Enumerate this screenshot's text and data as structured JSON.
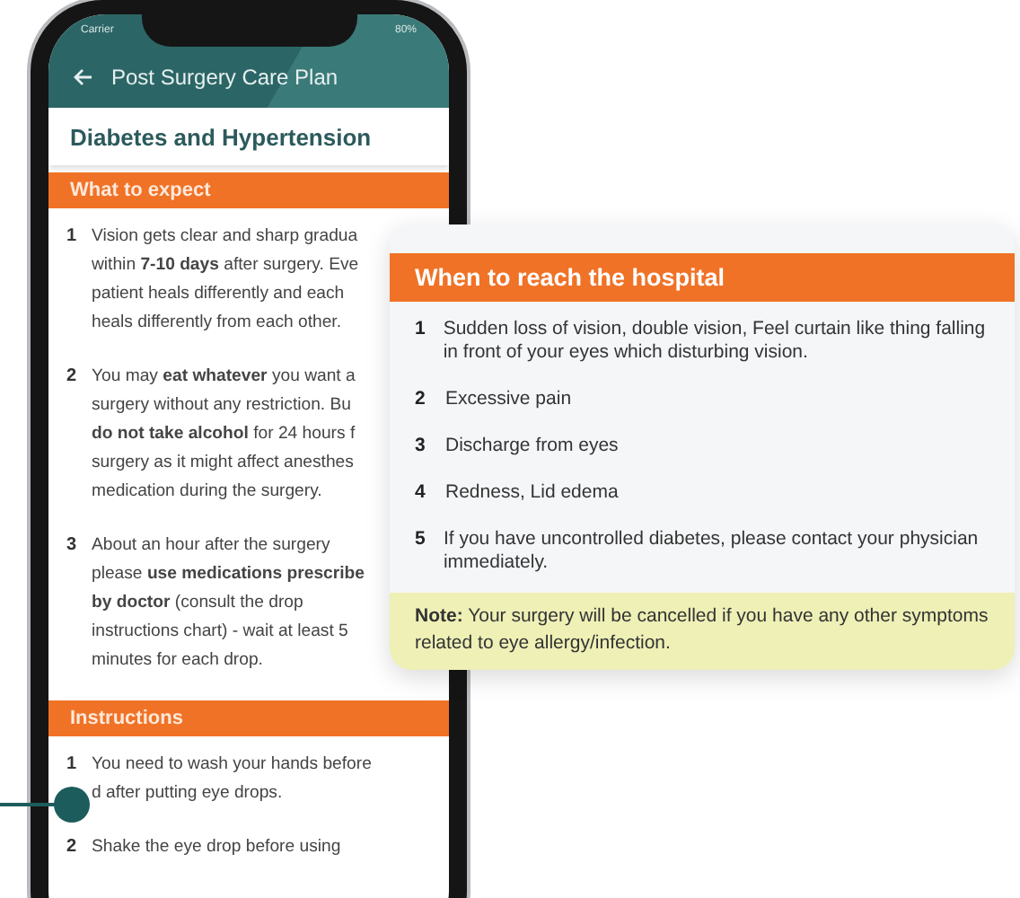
{
  "phone": {
    "status_bar": {
      "carrier": "Carrier",
      "battery": "80%"
    },
    "app_bar": {
      "title": "Post Surgery Care Plan"
    },
    "page_title": "Diabetes and Hypertension",
    "sections": [
      {
        "title": "What to expect",
        "items": [
          {
            "number": "1",
            "lines": [
              "Vision gets clear and sharp gradua",
              "within **7-10 days** after surgery. Eve",
              "patient heals differently and each",
              "heals differently from each other."
            ]
          },
          {
            "number": "2",
            "lines": [
              "You may **eat whatever** you want a",
              "surgery without any restriction. Bu",
              "**do not take alcohol** for 24 hours f",
              "surgery as it might affect anesthes",
              "medication during the surgery."
            ]
          },
          {
            "number": "3",
            "lines": [
              "About an hour after the surgery",
              "please **use medications prescribe**",
              "**by doctor** (consult the drop",
              "instructions chart) - wait at least 5",
              "minutes for each drop."
            ]
          }
        ]
      },
      {
        "title": "Instructions",
        "items": [
          {
            "number": "1",
            "lines": [
              "You need to wash your hands before",
              "d after putting eye drops."
            ]
          },
          {
            "number": "2",
            "lines": [
              "Shake the eye drop before using"
            ]
          }
        ]
      }
    ]
  },
  "callout": {
    "title": "When to reach the hospital",
    "items": [
      {
        "number": "1",
        "text": "Sudden loss of vision, double vision, Feel curtain like thing falling in front of your eyes which disturbing vision."
      },
      {
        "number": "2",
        "text": "Excessive pain"
      },
      {
        "number": "3",
        "text": "Discharge from eyes"
      },
      {
        "number": "4",
        "text": "Redness, Lid edema"
      },
      {
        "number": "5",
        "text": "If you have uncontrolled diabetes, please contact your physician immediately."
      }
    ],
    "note": "**Note:** Your surgery will be cancelled if you have any other symptoms related to eye allergy/infection."
  }
}
